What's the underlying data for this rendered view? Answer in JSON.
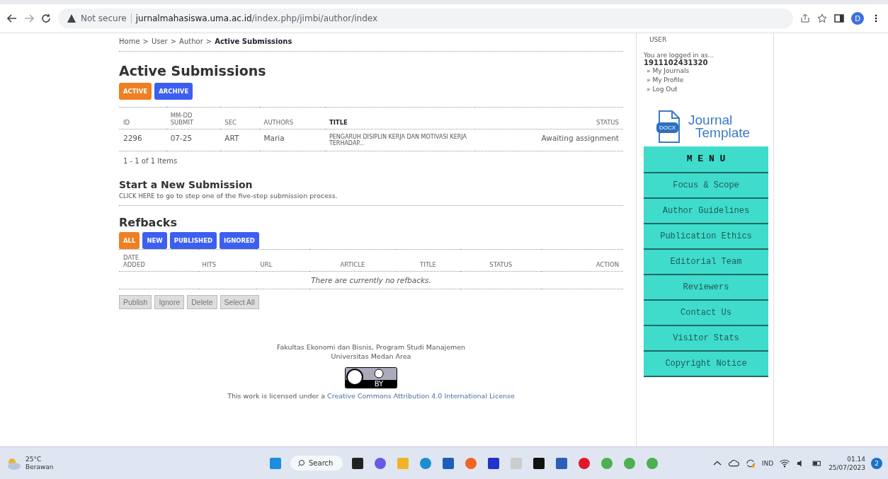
{
  "browser": {
    "security": "Not secure",
    "url_host": "jurnalmahasiswa.uma.ac.id",
    "url_path": "/index.php/jimbi/author/index",
    "profile": "D"
  },
  "breadcrumb": {
    "separator": ">",
    "items": [
      {
        "label": "Home",
        "current": false
      },
      {
        "label": "User",
        "current": false
      },
      {
        "label": "Author",
        "current": false
      },
      {
        "label": "Active Submissions",
        "current": true
      }
    ]
  },
  "submissions": {
    "title": "Active Submissions",
    "tabs": [
      {
        "label": "ACTIVE",
        "selected": true
      },
      {
        "label": "ARCHIVE",
        "selected": false
      }
    ],
    "columns": [
      {
        "lines": [
          "ID"
        ]
      },
      {
        "lines": [
          "MM-DD",
          "SUBMIT"
        ]
      },
      {
        "lines": [
          "SEC"
        ]
      },
      {
        "lines": [
          "AUTHORS"
        ]
      },
      {
        "lines": [
          "TITLE"
        ]
      },
      {
        "lines": [
          "STATUS"
        ]
      }
    ],
    "rows": [
      {
        "id": "2296",
        "submit": "07-25",
        "sec": "ART",
        "authors": "Maria",
        "title": "PENGARUH DISIPLIN KERJA DAN MOTIVASI KERJA TERHADAP...",
        "status": "Awaiting assignment"
      }
    ],
    "count": "1 - 1 of 1 Items"
  },
  "new_submission": {
    "title": "Start a New Submission",
    "link": "CLICK HERE",
    "text": " to go to step one of the five-step submission process."
  },
  "refbacks": {
    "title": "Refbacks",
    "tabs": [
      {
        "label": "ALL",
        "selected": true
      },
      {
        "label": "NEW",
        "selected": false
      },
      {
        "label": "PUBLISHED",
        "selected": false
      },
      {
        "label": "IGNORED",
        "selected": false
      }
    ],
    "columns": [
      {
        "lines": [
          "DATE",
          "ADDED"
        ]
      },
      {
        "lines": [
          "HITS"
        ]
      },
      {
        "lines": [
          "URL"
        ]
      },
      {
        "lines": [
          "ARTICLE"
        ]
      },
      {
        "lines": [
          "TITLE"
        ]
      },
      {
        "lines": [
          "STATUS"
        ]
      },
      {
        "lines": [
          "ACTION"
        ]
      }
    ],
    "empty": "There are currently no refbacks.",
    "buttons": [
      "Publish",
      "Ignore",
      "Delete",
      "Select All"
    ]
  },
  "footer": {
    "lines": [
      "Fakultas Ekonomi dan Bisnis, Program Studi Manajemen",
      "Universitas Medan Area"
    ],
    "license_prefix": "This work is licensed under a ",
    "license_link": "Creative Commons Attribution 4.0 International License",
    "badge_label": "BY"
  },
  "sidebar": {
    "heading": "USER",
    "logged_in": "You are logged in as...",
    "username": "1911102431320",
    "links": [
      {
        "bullet": "»",
        "label": "My Journals"
      },
      {
        "bullet": "»",
        "label": "My Profile"
      },
      {
        "bullet": "»",
        "label": "Log Out"
      }
    ],
    "logo": {
      "badge": "DOCX",
      "line1": "Journal",
      "line2": "Template"
    },
    "menu_title": "M E N U",
    "menu": [
      "Focus & Scope",
      "Author Guidelines",
      "Publication Ethics",
      "Editorial Team",
      "Reviewers",
      "Contact Us",
      "Visitor Stats",
      "Copyright Notice"
    ]
  },
  "taskbar": {
    "temperature": "25°C",
    "weather": "Berawan",
    "search": "Search",
    "language": "IND",
    "time": "01.14",
    "date": "25/07/2023",
    "notifications": "2"
  }
}
